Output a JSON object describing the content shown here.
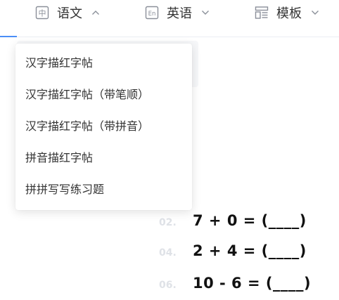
{
  "nav": {
    "tabs": [
      {
        "icon_text": "中",
        "label": "语文",
        "expanded": true
      },
      {
        "icon_text": "En",
        "label": "英语",
        "expanded": false
      },
      {
        "label": "模板",
        "expanded": false
      }
    ]
  },
  "dropdown": {
    "items": [
      "汉字描红字帖",
      "汉字描红字帖（带笔顺）",
      "汉字描红字帖（带拼音）",
      "拼音描红字帖",
      "拼拼写写练习题"
    ]
  },
  "worksheet": {
    "problems": [
      {
        "num": "02.",
        "expr": "7 + 0 = (____)"
      },
      {
        "num": "04.",
        "expr": "2 + 4 = (____)"
      },
      {
        "num": "06.",
        "expr": "10 - 6 = (____)"
      }
    ]
  },
  "colors": {
    "accent": "#4b8ef7",
    "icon_gray": "#8a8f99",
    "number_gray": "#dfe2e7"
  }
}
